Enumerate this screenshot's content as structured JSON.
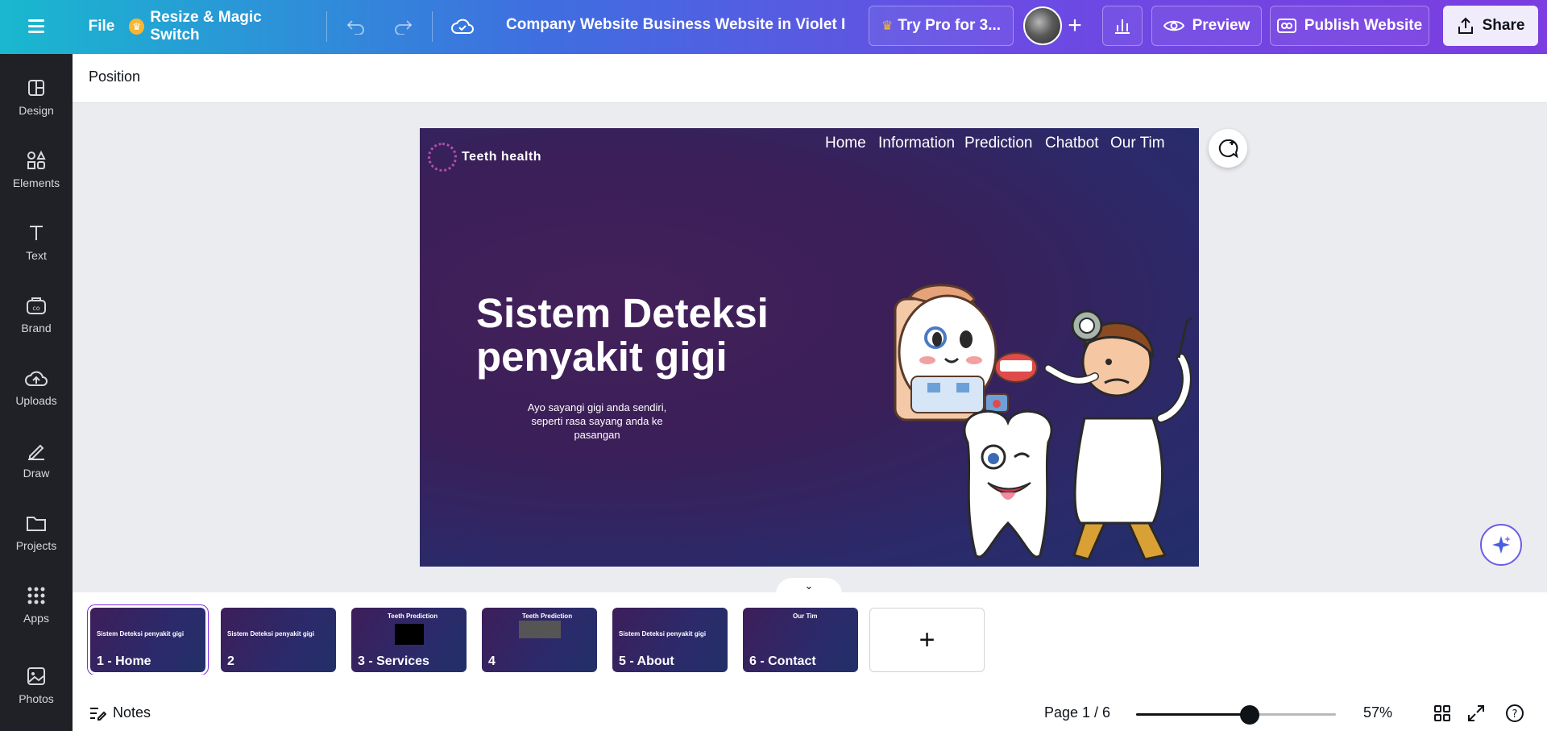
{
  "topbar": {
    "file_label": "File",
    "magic_label": "Resize & Magic Switch",
    "doc_title": "Company Website Business Website in Violet D...",
    "try_pro_label": "Try Pro for 3...",
    "preview_label": "Preview",
    "publish_label": "Publish Website",
    "share_label": "Share",
    "icons": [
      "menu-icon",
      "crown-icon",
      "undo-icon",
      "redo-icon",
      "cloud-check-icon",
      "add-user-icon",
      "stats-icon",
      "eye-icon",
      "publish-icon",
      "share-icon"
    ]
  },
  "sidebar": {
    "items": [
      {
        "label": "Design",
        "icon": "design-icon"
      },
      {
        "label": "Elements",
        "icon": "elements-icon"
      },
      {
        "label": "Text",
        "icon": "text-icon"
      },
      {
        "label": "Brand",
        "icon": "brand-icon"
      },
      {
        "label": "Uploads",
        "icon": "uploads-icon"
      },
      {
        "label": "Draw",
        "icon": "draw-icon"
      },
      {
        "label": "Projects",
        "icon": "folder-icon"
      },
      {
        "label": "Apps",
        "icon": "apps-icon"
      },
      {
        "label": "Photos",
        "icon": "photos-icon"
      }
    ]
  },
  "subbar": {
    "position_label": "Position"
  },
  "canvas": {
    "brand_name": "Teeth health",
    "nav": [
      "Home",
      "Information",
      "Prediction",
      "Chatbot",
      "Our Tim"
    ],
    "hero_title_line1": "Sistem Deteksi",
    "hero_title_line2": "penyakit gigi",
    "hero_sub_line1": "Ayo  sayangi gigi anda sendiri,",
    "hero_sub_line2": "seperti rasa sayang anda ke pasangan"
  },
  "thumbnails": [
    {
      "label": "1 - Home",
      "mini": "Sistem Deteksi penyakit gigi",
      "active": true
    },
    {
      "label": "2",
      "mini": "Sistem Deteksi penyakit gigi",
      "active": false
    },
    {
      "label": "3 - Services",
      "mini": "Teeth Prediction",
      "active": false
    },
    {
      "label": "4",
      "mini": "Teeth Prediction",
      "active": false
    },
    {
      "label": "5 - About",
      "mini": "Sistem Deteksi penyakit gigi",
      "active": false
    },
    {
      "label": "6 - Contact",
      "mini": "Our Tim",
      "active": false
    }
  ],
  "bottombar": {
    "notes_label": "Notes",
    "page_indicator": "Page 1 / 6",
    "zoom_label": "57%",
    "zoom_fraction": 0.57
  },
  "colors": {
    "accent": "#7d2ae8",
    "sidebar_bg": "#1f2126",
    "canvas_purple": "#3a1f58",
    "canvas_navy": "#232e6b"
  }
}
